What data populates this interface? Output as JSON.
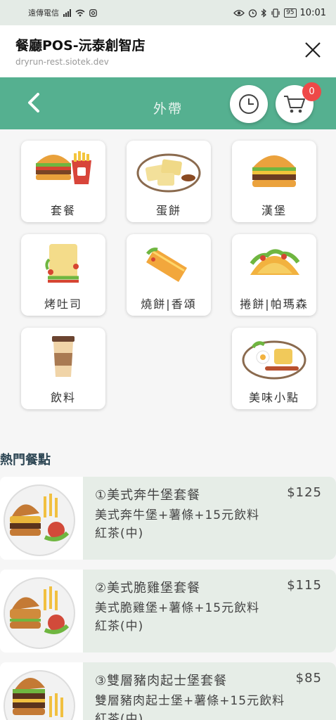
{
  "status_bar": {
    "carrier": "遠傳電信",
    "battery": "95",
    "time": "10:01"
  },
  "titlebar": {
    "name": "餐廳POS-沅泰創智店",
    "url": "dryrun-rest.siotek.dev"
  },
  "header": {
    "title": "外帶",
    "cart_count": "0"
  },
  "categories": [
    {
      "label": "套餐",
      "icon": "combo-meal-icon"
    },
    {
      "label": "蛋餅",
      "icon": "egg-roll-icon"
    },
    {
      "label": "漢堡",
      "icon": "burger-icon"
    },
    {
      "label": "烤吐司",
      "icon": "toast-sandwich-icon"
    },
    {
      "label": "燒餅|香頌",
      "icon": "wrap-icon"
    },
    {
      "label": "捲餅|帕瑪森",
      "icon": "taco-icon"
    },
    {
      "label": "飲料",
      "icon": "coffee-cup-icon"
    },
    {
      "label": "美味小點",
      "icon": "breakfast-plate-icon"
    }
  ],
  "popular": {
    "title": "熱門餐點",
    "items": [
      {
        "name": "①美式奔牛堡套餐",
        "price": "$125",
        "desc1": "美式奔牛堡+薯條+15元飲料",
        "desc2": "紅茶(中)"
      },
      {
        "name": "②美式脆雞堡套餐",
        "price": "$115",
        "desc1": "美式脆雞堡+薯條+15元飲料",
        "desc2": "紅茶(中)"
      },
      {
        "name": "③雙層豬肉起士堡套餐",
        "price": "$85",
        "desc1": "雙層豬肉起士堡+薯條+15元飲料",
        "desc2": "紅茶(中)"
      }
    ]
  },
  "colors": {
    "header_green": "#55b090",
    "badge_red": "#ee4848",
    "item_bg": "#e6ede7"
  }
}
